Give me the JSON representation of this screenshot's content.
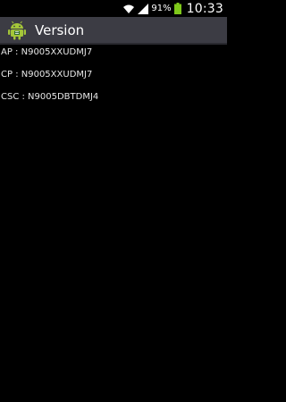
{
  "status_bar": {
    "battery_percent": "91%",
    "time": "10:33",
    "icons": [
      "wifi-icon",
      "signal-icon",
      "battery-icon"
    ]
  },
  "action_bar": {
    "title": "Version",
    "icon": "android-icon"
  },
  "versions": [
    {
      "text": "AP : N9005XXUDMJ7"
    },
    {
      "text": "CP : N9005XXUDMJ7"
    },
    {
      "text": "CSC : N9005DBTDMJ4"
    }
  ],
  "colors": {
    "background": "#000000",
    "action_bar": "#3c3c44",
    "android_green": "#a4c639",
    "battery_green": "#7fc81a"
  }
}
